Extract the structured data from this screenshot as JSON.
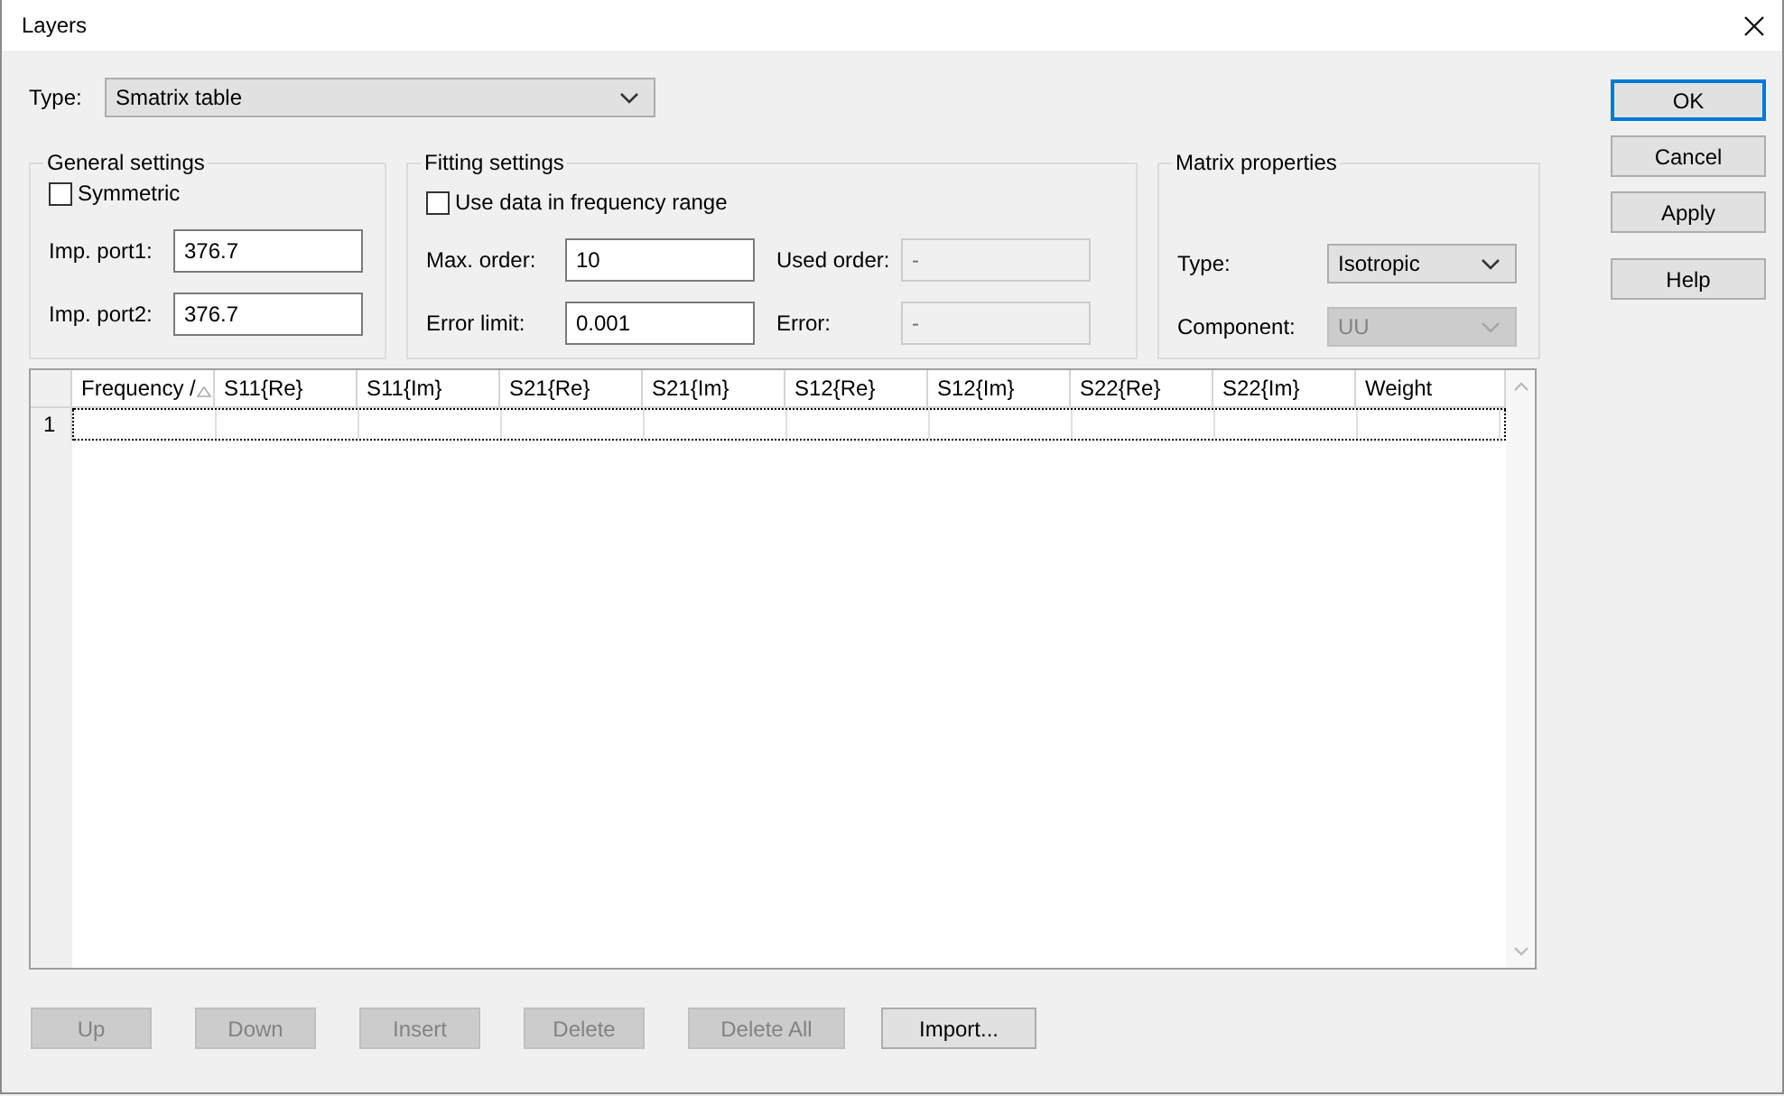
{
  "window": {
    "title": "Layers"
  },
  "type_field": {
    "label": "Type:",
    "value": "Smatrix table"
  },
  "general_settings": {
    "title": "General settings",
    "symmetric": {
      "label": "Symmetric",
      "checked": false
    },
    "fields": [
      {
        "label": "Imp. port1:",
        "value": "376.7"
      },
      {
        "label": "Imp. port2:",
        "value": "376.7"
      }
    ]
  },
  "fitting_settings": {
    "title": "Fitting settings",
    "use_range": {
      "label": "Use data in frequency range",
      "checked": false
    },
    "fields": [
      {
        "label": "Max. order:",
        "value": "10",
        "disabled": false
      },
      {
        "label": "Used order:",
        "value": "-",
        "disabled": true
      },
      {
        "label": "Error limit:",
        "value": "0.001",
        "disabled": false
      },
      {
        "label": "Error:",
        "value": "-",
        "disabled": true
      }
    ]
  },
  "matrix_properties": {
    "title": "Matrix properties",
    "fields": [
      {
        "label": "Type:",
        "value": "Isotropic",
        "disabled": false
      },
      {
        "label": "Component:",
        "value": "UU",
        "disabled": true
      }
    ]
  },
  "table": {
    "columns": [
      {
        "label": "Frequency /",
        "sorted": true
      },
      {
        "label": "S11{Re}",
        "sorted": false
      },
      {
        "label": "S11{Im}",
        "sorted": false
      },
      {
        "label": "S21{Re}",
        "sorted": false
      },
      {
        "label": "S21{Im}",
        "sorted": false
      },
      {
        "label": "S12{Re}",
        "sorted": false
      },
      {
        "label": "S12{Im}",
        "sorted": false
      },
      {
        "label": "S22{Re}",
        "sorted": false
      },
      {
        "label": "S22{Im}",
        "sorted": false
      },
      {
        "label": "Weight",
        "sorted": false
      }
    ],
    "rows": [
      {
        "number": "1",
        "selected": true
      }
    ]
  },
  "dialog_buttons": [
    {
      "label": "OK",
      "default": true
    },
    {
      "label": "Cancel",
      "default": false
    },
    {
      "label": "Apply",
      "default": false
    },
    {
      "label": "Help",
      "default": false
    }
  ],
  "row_buttons": [
    {
      "label": "Up",
      "disabled": true
    },
    {
      "label": "Down",
      "disabled": true
    },
    {
      "label": "Insert",
      "disabled": true
    },
    {
      "label": "Delete",
      "disabled": true
    },
    {
      "label": "Delete All",
      "disabled": true
    },
    {
      "label": "Import...",
      "disabled": false
    }
  ]
}
